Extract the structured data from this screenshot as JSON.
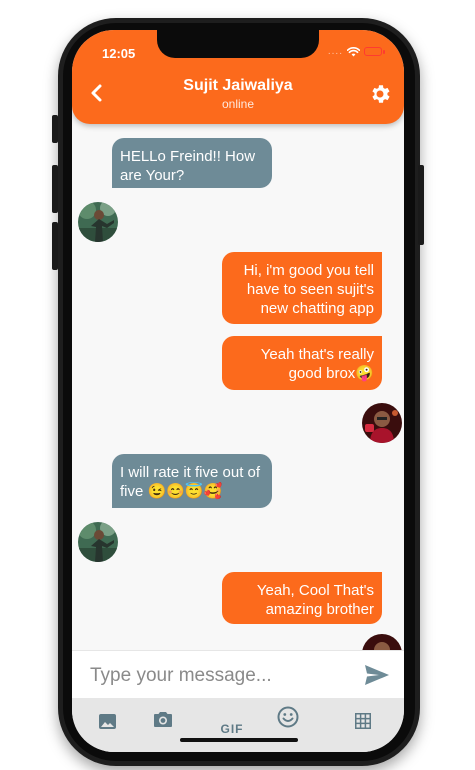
{
  "status_bar": {
    "time": "12:05",
    "signal": "....",
    "wifi_icon": "wifi-icon",
    "battery_icon": "battery-low-icon",
    "battery_color": "#ff3b30"
  },
  "header": {
    "back_icon": "chevron-left-icon",
    "contact_name": "Sujit Jaiwaliya",
    "contact_status": "online",
    "settings_icon": "gear-icon",
    "color": "#fc6a1c"
  },
  "messages": [
    {
      "direction": "incoming",
      "text": "HELLo Freind!! How are Your?"
    },
    {
      "direction": "outgoing",
      "text": "Hi, i'm good you tell have to seen sujit's new chatting app"
    },
    {
      "direction": "outgoing",
      "text": "Yeah that's really good brox🤪"
    },
    {
      "direction": "incoming",
      "text": "I will rate it five out of five 😉😊😇🥰"
    },
    {
      "direction": "outgoing",
      "text": "Yeah, Cool That's amazing brother"
    }
  ],
  "colors": {
    "incoming_bubble": "#6e8b97",
    "outgoing_bubble": "#fc6a1c",
    "background": "#f8f8f8"
  },
  "composer": {
    "placeholder": "Type your message...",
    "value": "",
    "send_icon": "send-icon"
  },
  "toolbar": {
    "items": [
      {
        "icon": "image-icon"
      },
      {
        "icon": "camera-icon"
      },
      {
        "icon": "gif-icon",
        "label": "GIF"
      },
      {
        "icon": "emoji-icon"
      },
      {
        "icon": "grid-icon"
      }
    ]
  }
}
